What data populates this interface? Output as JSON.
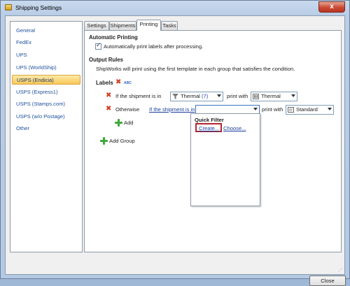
{
  "window": {
    "title": "Shipping Settings",
    "close_glyph": "x"
  },
  "nav": {
    "items": [
      {
        "label": "General",
        "selected": false
      },
      {
        "label": "FedEx",
        "selected": false
      },
      {
        "label": "UPS",
        "selected": false
      },
      {
        "label": "UPS (WorldShip)",
        "selected": false
      },
      {
        "label": "USPS (Endicia)",
        "selected": true
      },
      {
        "label": "USPS (Express1)",
        "selected": false
      },
      {
        "label": "USPS (Stamps.com)",
        "selected": false
      },
      {
        "label": "USPS (w/o Postage)",
        "selected": false
      },
      {
        "label": "Other",
        "selected": false
      }
    ]
  },
  "tabs": [
    {
      "label": "Settings",
      "active": false
    },
    {
      "label": "Shipments",
      "active": false
    },
    {
      "label": "Printing",
      "active": true
    },
    {
      "label": "Tasks",
      "active": false
    }
  ],
  "printing": {
    "auto_heading": "Automatic Printing",
    "auto_checkbox_label": "Automatically print labels after processing.",
    "auto_checked": true,
    "output_heading": "Output Rules",
    "output_desc": "ShipWorks will print using the first template in each group that satisfies the condition.",
    "labels_title": "Labels",
    "abc_badge": "ABC",
    "rule1": {
      "prefix": "If the shipment is in",
      "filter_value": "Thermal",
      "filter_count": "(7)",
      "print_with": "print with",
      "template_value": "Thermal"
    },
    "rule2": {
      "otherwise": "Otherwise",
      "condition_link": "If the shipment is in",
      "print_with": "print with",
      "template_value": "Standard"
    },
    "add_label": "Add",
    "add_group_label": "Add Group"
  },
  "popup": {
    "title": "Quick Filter",
    "create_link": "Create...",
    "choose_link": "Choose..."
  },
  "footer": {
    "close_label": "Close"
  },
  "colors": {
    "accent_link": "#1a3f9c",
    "delete_red": "#d23b1d",
    "add_green": "#3fa83a",
    "selection_gold": "#f8c85a"
  }
}
